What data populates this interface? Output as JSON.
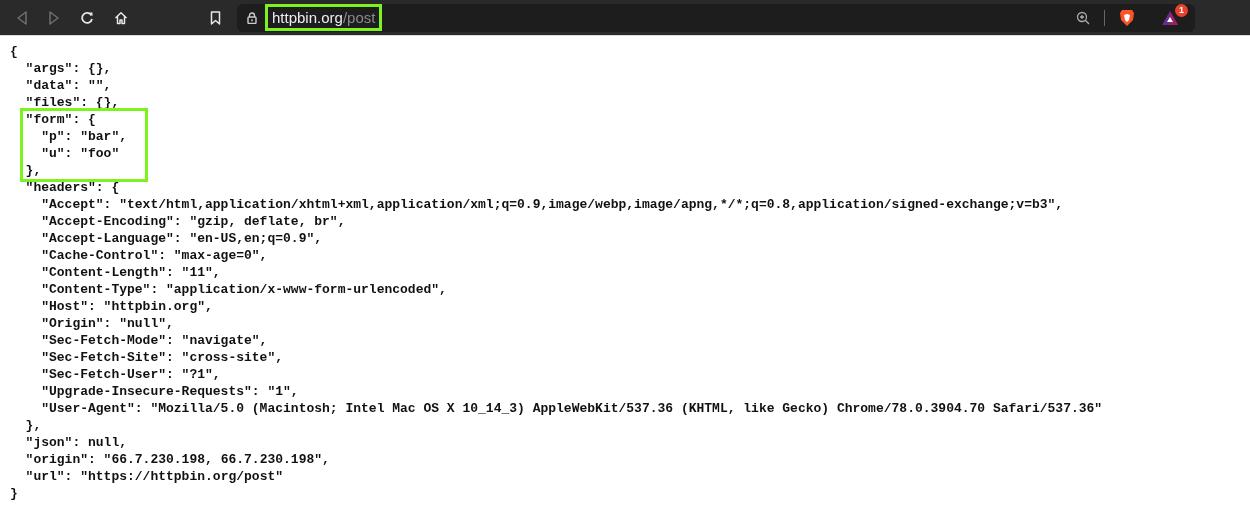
{
  "toolbar": {
    "back_disabled": true,
    "forward_disabled": true,
    "address": {
      "host": "httpbin.org",
      "path": "/post",
      "highlighted": true
    },
    "rewards_badge": "1"
  },
  "document": {
    "text": "{",
    "close": "}",
    "highlighted": false,
    "children": [
      {
        "text": "\"args\": {},"
      },
      {
        "text": "\"data\": \"\","
      },
      {
        "text": "\"files\": {},"
      },
      {
        "text": "\"form\": {",
        "close": "},",
        "highlighted": true,
        "children": [
          {
            "text": "\"p\": \"bar\","
          },
          {
            "text": "\"u\": \"foo\""
          }
        ]
      },
      {
        "text": "\"headers\": {",
        "close": "},",
        "highlighted": false,
        "children": [
          {
            "text": "\"Accept\": \"text/html,application/xhtml+xml,application/xml;q=0.9,image/webp,image/apng,*/*;q=0.8,application/signed-exchange;v=b3\","
          },
          {
            "text": "\"Accept-Encoding\": \"gzip, deflate, br\","
          },
          {
            "text": "\"Accept-Language\": \"en-US,en;q=0.9\","
          },
          {
            "text": "\"Cache-Control\": \"max-age=0\","
          },
          {
            "text": "\"Content-Length\": \"11\","
          },
          {
            "text": "\"Content-Type\": \"application/x-www-form-urlencoded\","
          },
          {
            "text": "\"Host\": \"httpbin.org\","
          },
          {
            "text": "\"Origin\": \"null\","
          },
          {
            "text": "\"Sec-Fetch-Mode\": \"navigate\","
          },
          {
            "text": "\"Sec-Fetch-Site\": \"cross-site\","
          },
          {
            "text": "\"Sec-Fetch-User\": \"?1\","
          },
          {
            "text": "\"Upgrade-Insecure-Requests\": \"1\","
          },
          {
            "text": "\"User-Agent\": \"Mozilla/5.0 (Macintosh; Intel Mac OS X 10_14_3) AppleWebKit/537.36 (KHTML, like Gecko) Chrome/78.0.3904.70 Safari/537.36\""
          }
        ]
      },
      {
        "text": "\"json\": null,"
      },
      {
        "text": "\"origin\": \"66.7.230.198, 66.7.230.198\","
      },
      {
        "text": "\"url\": \"https://httpbin.org/post\""
      }
    ]
  }
}
